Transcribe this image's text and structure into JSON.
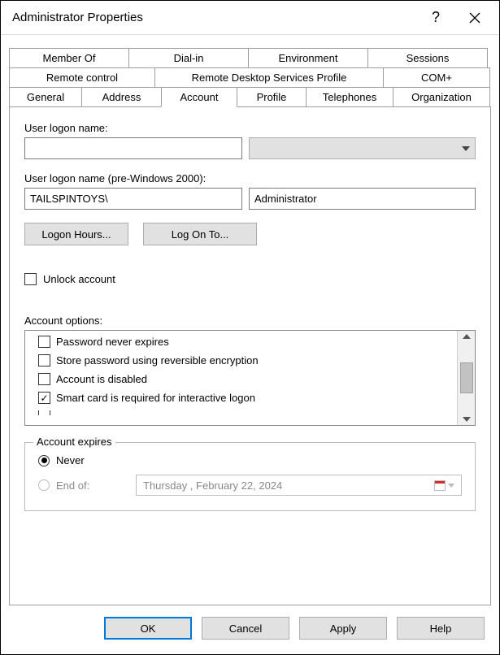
{
  "window": {
    "title": "Administrator Properties"
  },
  "tabs": {
    "row1": [
      "Member Of",
      "Dial-in",
      "Environment",
      "Sessions"
    ],
    "row2": [
      "Remote control",
      "Remote Desktop Services Profile",
      "COM+"
    ],
    "row3": [
      "General",
      "Address",
      "Account",
      "Profile",
      "Telephones",
      "Organization"
    ],
    "active": "Account"
  },
  "account": {
    "logon_label": "User logon name:",
    "logon_value": "",
    "logon_pre_label": "User logon name (pre-Windows 2000):",
    "domain_value": "TAILSPINTOYS\\",
    "username_value": "Administrator",
    "btn_hours": "Logon Hours...",
    "btn_logon_to": "Log On To...",
    "unlock_label": "Unlock account",
    "unlock_checked": false,
    "options_label": "Account options:",
    "options": [
      {
        "label": "Password never expires",
        "checked": false
      },
      {
        "label": "Store password using reversible encryption",
        "checked": false
      },
      {
        "label": "Account is disabled",
        "checked": false
      },
      {
        "label": "Smart card is required for interactive logon",
        "checked": true
      }
    ],
    "expires": {
      "group_title": "Account expires",
      "never_label": "Never",
      "endof_label": "End of:",
      "selected": "never",
      "date_display": "Thursday ,   February  22, 2024"
    }
  },
  "footer": {
    "ok": "OK",
    "cancel": "Cancel",
    "apply": "Apply",
    "help": "Help"
  }
}
